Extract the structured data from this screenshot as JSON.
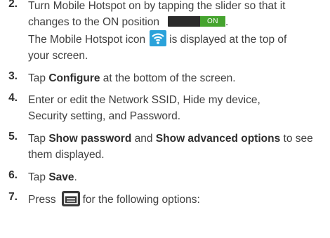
{
  "steps": [
    {
      "number": "2.",
      "line1": "Turn Mobile Hotspot on by tapping the slider so that it",
      "line2_before": "changes to the ON position",
      "toggle_label": "ON",
      "line2_after": ".",
      "line3_before": "The Mobile Hotspot icon",
      "line3_after": "is displayed at the top of",
      "line4": "your screen."
    },
    {
      "number": "3.",
      "before": "Tap ",
      "bold": "Configure",
      "after": " at the bottom of the screen."
    },
    {
      "number": "4.",
      "line1": "Enter or edit the Network SSID, Hide my device,",
      "line2": "Security setting, and Password."
    },
    {
      "number": "5.",
      "before": "Tap ",
      "bold1": "Show password",
      "middle": " and ",
      "bold2": "Show advanced options",
      "after": " to see",
      "line2": "them displayed."
    },
    {
      "number": "6.",
      "before": "Tap ",
      "bold": "Save",
      "after": "."
    },
    {
      "number": "7.",
      "before": "Press",
      "after": "for the following options:"
    }
  ],
  "colors": {
    "toggle_on": "#45a32e",
    "toggle_track": "#2b2b2b",
    "hotspot_icon_bg": "#2aa2da",
    "menu_key_bg": "#3a3a3a"
  },
  "icons": {
    "hotspot": "wifi-hotspot-icon",
    "menu": "menu-key-icon"
  }
}
